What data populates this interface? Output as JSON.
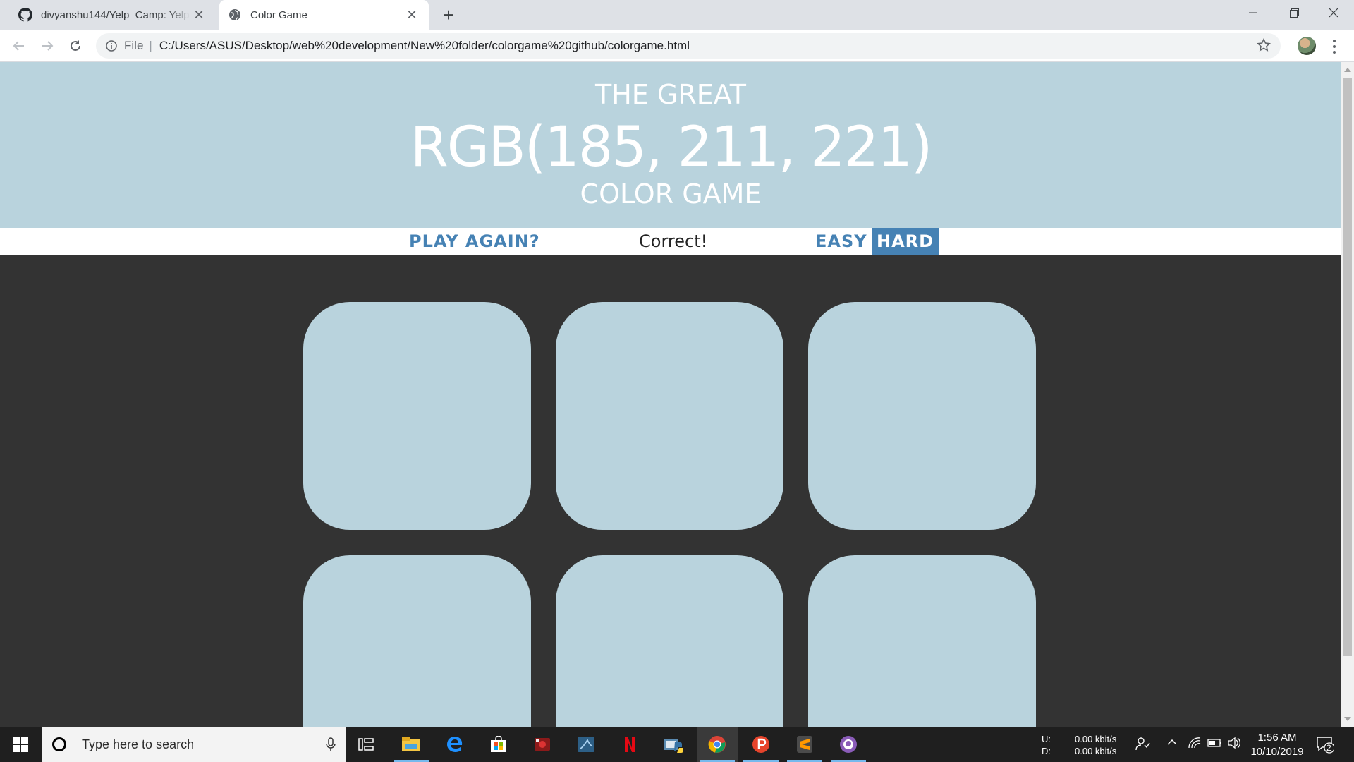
{
  "browser": {
    "tabs": [
      {
        "title": "divyanshu144/Yelp_Camp: YelpCamp",
        "active": false,
        "icon": "github-icon"
      },
      {
        "title": "Color Game",
        "active": true,
        "icon": "globe-icon"
      }
    ],
    "address": {
      "scheme": "File",
      "url": "C:/Users/ASUS/Desktop/web%20development/New%20folder/colorgame%20github/colorgame.html"
    }
  },
  "page": {
    "header": {
      "line1": "THE GREAT",
      "rgb": "RGB(185, 211, 221)",
      "line3": "COLOR GAME"
    },
    "stripe": {
      "reset": "PLAY AGAIN?",
      "message": "Correct!",
      "easy": "EASY",
      "hard": "HARD",
      "selected_mode": "HARD"
    },
    "squares": [
      "rgb(185, 211, 221)",
      "rgb(185, 211, 221)",
      "rgb(185, 211, 221)",
      "rgb(185, 211, 221)",
      "rgb(185, 211, 221)",
      "rgb(185, 211, 221)"
    ],
    "colors": {
      "header_bg": "#b9d3dd",
      "body_bg": "#333333",
      "accent": "#4682b4"
    }
  },
  "taskbar": {
    "search_placeholder": "Type here to search",
    "apps": [
      "task-view-icon",
      "file-explorer-icon",
      "edge-icon",
      "store-icon",
      "media-app-icon",
      "mysql-workbench-icon",
      "netflix-icon",
      "python-icon",
      "chrome-icon",
      "postman-icon",
      "sublime-text-icon",
      "github-desktop-icon"
    ],
    "net_up_label": "U:",
    "net_down_label": "D:",
    "net_up": "0.00 kbit/s",
    "net_down": "0.00 kbit/s",
    "time": "1:56 AM",
    "date": "10/10/2019",
    "notifications": "2"
  }
}
